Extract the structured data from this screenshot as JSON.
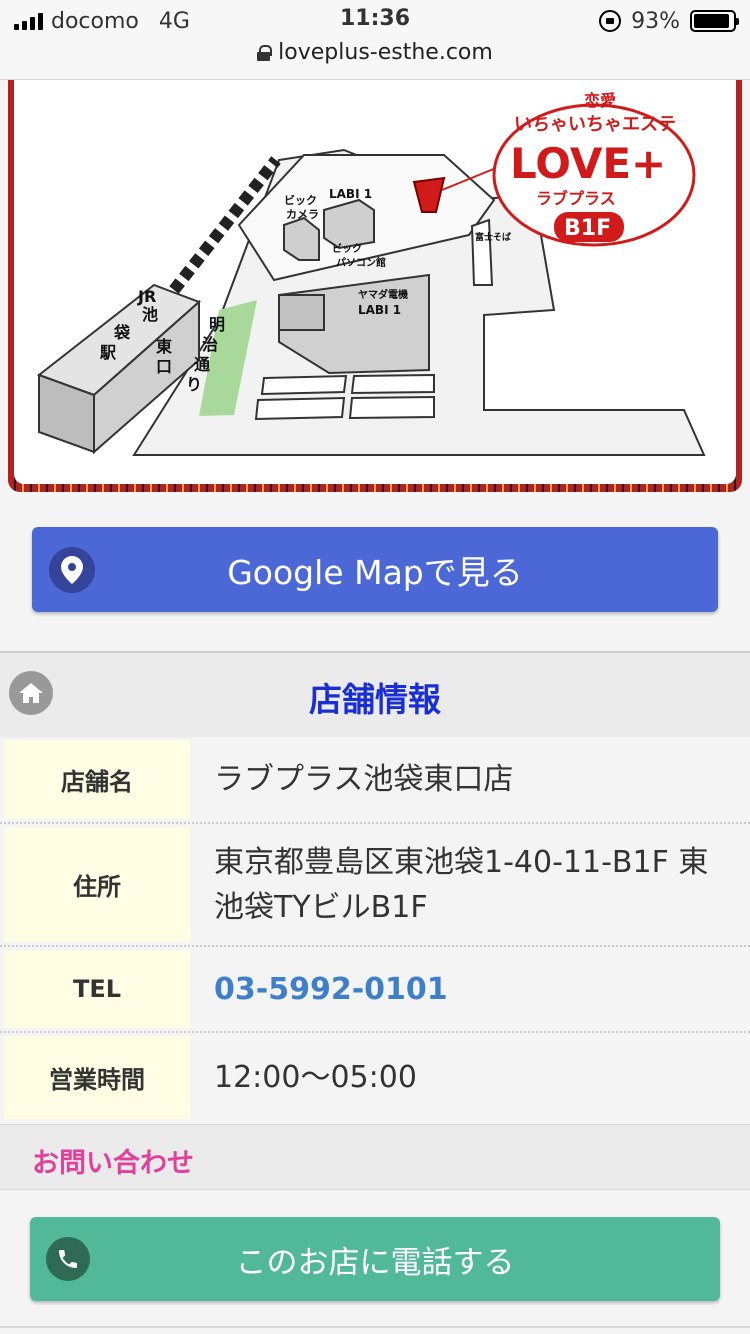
{
  "status_bar": {
    "carrier": "docomo",
    "network": "4G",
    "time": "11:36",
    "battery": "93%",
    "battery_level": 0.93,
    "url": "loveplus-esthe.com"
  },
  "map": {
    "logo_top": "恋愛",
    "logo_tagline": "いちゃいちゃエステ",
    "logo_main": "LOVE+",
    "logo_kana": "ラブプラス",
    "logo_floor": "B1F",
    "labels": {
      "bic_camera": "ビック\nカメラ",
      "labi1_top": "LABI 1",
      "bic_pc": "ビック\nパソコン館",
      "yamada": "ヤマダ電機\nLABI 1",
      "jr": "JR\n池\n袋\n駅",
      "east_exit": "東\n口",
      "meiji": "明\n治\n通\nり",
      "fujisoba": "富士そば"
    },
    "colors": {
      "accent_red": "#d11b1b",
      "road": "#f2f2f2",
      "building": "#cfcfcf",
      "park": "#a8d99a"
    }
  },
  "google_map_button": {
    "label": "Google Mapで見る",
    "icon": "map-pin-icon",
    "color": "#4b68d6"
  },
  "shop_info": {
    "title": "店舗情報",
    "icon": "home-icon",
    "rows": [
      {
        "label": "店舗名",
        "value": "ラブプラス池袋東口店"
      },
      {
        "label": "住所",
        "value": "東京都豊島区東池袋1-40-11-B1F 東池袋TYビルB1F"
      },
      {
        "label": "TEL",
        "value": "03-5992-0101"
      },
      {
        "label": "営業時間",
        "value": "12:00〜05:00"
      }
    ]
  },
  "inquiry": {
    "title": "お問い合わせ"
  },
  "call_button": {
    "label": "このお店に電話する",
    "icon": "phone-icon",
    "color": "#52b998"
  }
}
